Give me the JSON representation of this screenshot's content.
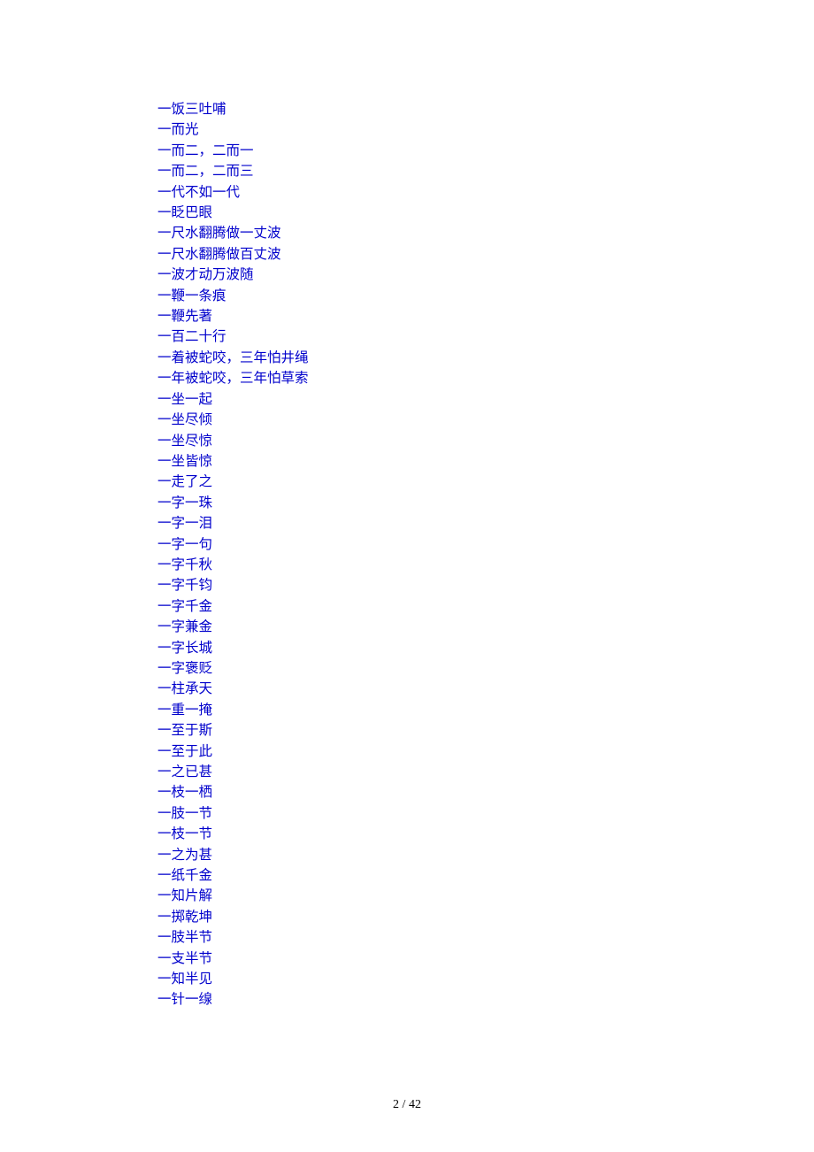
{
  "idioms": [
    "一饭三吐哺",
    "一而光",
    "一而二，二而一",
    "一而二，二而三",
    "一代不如一代",
    "一眨巴眼",
    "一尺水翻腾做一丈波",
    "一尺水翻腾做百丈波",
    "一波才动万波随",
    "一鞭一条痕",
    "一鞭先著",
    "一百二十行",
    "一着被蛇咬，三年怕井绳",
    "一年被蛇咬，三年怕草索",
    "一坐一起",
    "一坐尽倾",
    "一坐尽惊",
    "一坐皆惊",
    "一走了之",
    "一字一珠",
    "一字一泪",
    "一字一句",
    "一字千秋",
    "一字千钧",
    "一字千金",
    "一字兼金",
    "一字长城",
    "一字褒贬",
    "一柱承天",
    "一重一掩",
    "一至于斯",
    "一至于此",
    "一之已甚",
    "一枝一栖",
    "一肢一节",
    "一枝一节",
    "一之为甚",
    "一纸千金",
    "一知片解",
    "一掷乾坤",
    "一肢半节",
    "一支半节",
    "一知半见",
    "一针一缐"
  ],
  "pager": {
    "current": "2",
    "separator": " / ",
    "total": "42"
  }
}
